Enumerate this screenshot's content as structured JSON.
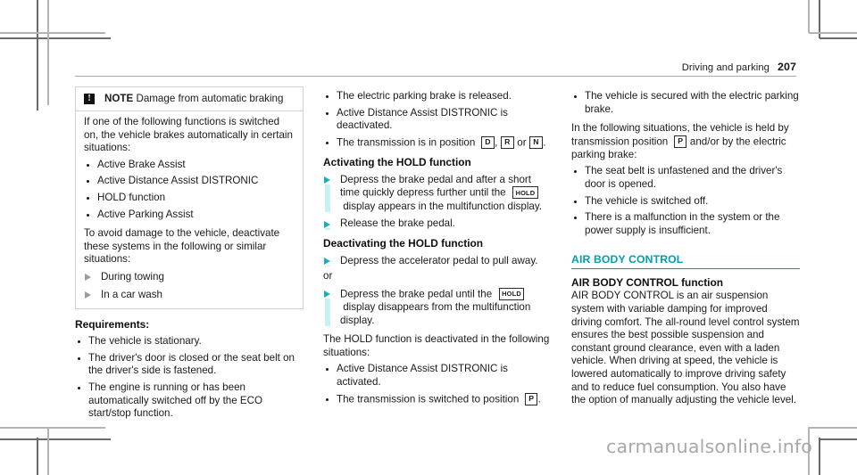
{
  "header": {
    "title": "Driving and parking",
    "page_number": "207"
  },
  "note_box": {
    "icon": "warning-exclamation-icon",
    "label": "NOTE",
    "title": "Damage from automatic braking",
    "intro": "If one of the following functions is switched on, the vehicle brakes automatically in certain situations:",
    "functions": [
      "Active Brake Assist",
      "Active Distance Assist DISTRONIC",
      "HOLD function",
      "Active Parking Assist"
    ],
    "deactivate_intro": "To avoid damage to the vehicle, deactivate these systems in the following or similar situations:",
    "deactivate_actions": [
      "During towing",
      "In a car wash"
    ]
  },
  "requirements": {
    "heading": "Requirements:",
    "items_left": [
      "The vehicle is stationary.",
      "The driver's door is closed or the seat belt on the driver's side is fastened.",
      "The engine is running or has been automatically switched off by the ECO start/stop function."
    ],
    "items_middle": [
      "The electric parking brake is released.",
      "Active Distance Assist DISTRONIC is deactivated."
    ],
    "transmission_prefix": "The transmission is in position",
    "transmission_positions": [
      "D",
      "R",
      "N"
    ],
    "transmission_sep": ", ",
    "transmission_or": " or ",
    "transmission_suffix": "."
  },
  "activating": {
    "heading": "Activating the HOLD function",
    "step1_a": "Depress the brake pedal and after a short time quickly depress further until the",
    "step1_badge": "HOLD",
    "step1_b": "display appears in the multifunction display.",
    "step2": "Release the brake pedal."
  },
  "deactivating": {
    "heading": "Deactivating the HOLD function",
    "step1": "Depress the accelerator pedal to pull away.",
    "or": "or",
    "step2_a": "Depress the brake pedal until the",
    "step2_badge": "HOLD",
    "step2_b": "display disappears from the multifunction display.",
    "outro": "The HOLD function is deactivated in the following situations:",
    "situations": [
      "Active Distance Assist DISTRONIC is activated.",
      "The transmission is switched to position"
    ],
    "situation2_badge": "P",
    "situation2_suffix": "."
  },
  "secured": {
    "item": "The vehicle is secured with the electric parking brake.",
    "held_prefix": "In the following situations, the vehicle is held by transmission position",
    "held_badge": "P",
    "held_suffix": "and/or by the electric parking brake:",
    "held_items": [
      "The seat belt is unfastened and the driver's door is opened.",
      "The vehicle is switched off.",
      "There is a malfunction in the system or the power supply is insufficient."
    ]
  },
  "air_body_control": {
    "section_title": "AIR BODY CONTROL",
    "subheading": "AIR BODY CONTROL function",
    "body": "AIR BODY CONTROL is an air suspension system with variable damping for improved driving comfort. The all-round level control system ensures the best possible suspension and constant ground clearance, even with a laden vehicle. When driving at speed, the vehicle is lowered automatically to improve driving safety and to reduce fuel consumption. You also have the option of manually adjusting the vehicle level."
  },
  "watermark": {
    "text": "carmanualsonline.info"
  },
  "colors": {
    "accent_teal": "#00a0ac",
    "action_triangle": "#13b2ba",
    "action_bar": "#c9f0f2",
    "header_rule": "#9fb0ae",
    "note_border": "#d2d2d2",
    "watermark": "#a8a8a8"
  }
}
